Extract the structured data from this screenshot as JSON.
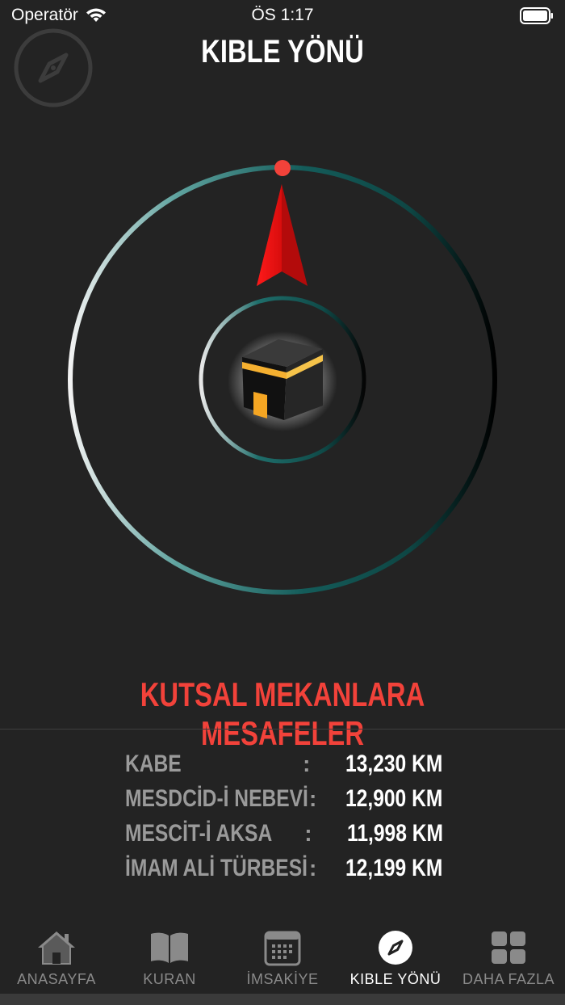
{
  "status_bar": {
    "carrier": "Operatör",
    "time": "ÖS 1:17"
  },
  "header": {
    "title": "KIBLE YÖNÜ"
  },
  "colors": {
    "accent_red": "#f2423a",
    "ring_teal": "#145c5a",
    "background": "#232323",
    "kaaba_gold": "#f5a623"
  },
  "distances": {
    "title": "KUTSAL MEKANLARA MESAFELER",
    "items": [
      {
        "name": "KABE",
        "sep": ":",
        "value": "13,230 KM"
      },
      {
        "name": "MESDCİD-İ NEBEVİ",
        "sep": ":",
        "value": "12,900 KM"
      },
      {
        "name": "MESCİT-İ AKSA",
        "sep": ":",
        "value": "11,998 KM"
      },
      {
        "name": "İMAM ALİ TÜRBESİ",
        "sep": ":",
        "value": "12,199 KM"
      }
    ]
  },
  "tabs": [
    {
      "label": "ANASAYFA",
      "icon": "home-icon",
      "active": false
    },
    {
      "label": "KURAN",
      "icon": "book-icon",
      "active": false
    },
    {
      "label": "İMSAKİYE",
      "icon": "calendar-icon",
      "active": false
    },
    {
      "label": "KIBLE YÖNÜ",
      "icon": "compass-icon",
      "active": true
    },
    {
      "label": "DAHA FAZLA",
      "icon": "grid-icon",
      "active": false
    }
  ]
}
